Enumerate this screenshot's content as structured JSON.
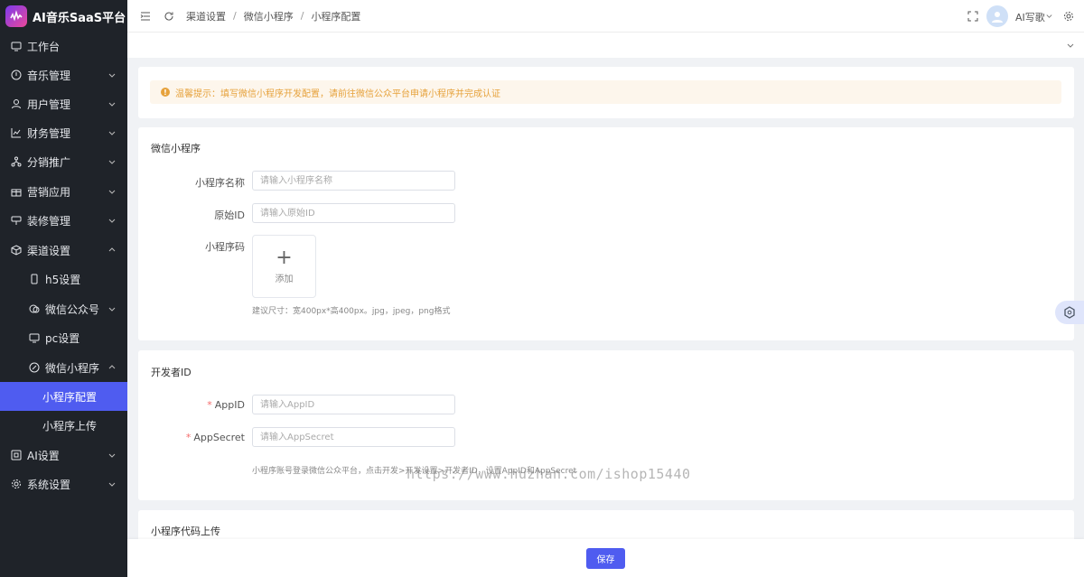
{
  "brand": {
    "title": "AI音乐SaaS平台"
  },
  "sidebar": {
    "items": [
      {
        "label": "工作台",
        "icon": "monitor-icon"
      },
      {
        "label": "音乐管理",
        "icon": "music-icon"
      },
      {
        "label": "用户管理",
        "icon": "user-icon"
      },
      {
        "label": "财务管理",
        "icon": "chart-icon"
      },
      {
        "label": "分销推广",
        "icon": "network-icon"
      },
      {
        "label": "营销应用",
        "icon": "gift-icon"
      },
      {
        "label": "装修管理",
        "icon": "paint-icon"
      },
      {
        "label": "渠道设置",
        "icon": "cube-icon"
      },
      {
        "label": "h5设置",
        "icon": "phone-icon"
      },
      {
        "label": "微信公众号",
        "icon": "wechat-icon"
      },
      {
        "label": "pc设置",
        "icon": "desktop-icon"
      },
      {
        "label": "微信小程序",
        "icon": "miniprogram-icon"
      },
      {
        "label": "小程序配置"
      },
      {
        "label": "小程序上传"
      },
      {
        "label": "AI设置",
        "icon": "ai-icon"
      },
      {
        "label": "系统设置",
        "icon": "gear-icon"
      }
    ]
  },
  "header": {
    "breadcrumb": [
      "渠道设置",
      "微信小程序",
      "小程序配置"
    ],
    "user_name": "AI写歌"
  },
  "alert": {
    "text": "温馨提示：填写微信小程序开发配置，请前往微信公众平台申请小程序并完成认证"
  },
  "section_mini": {
    "title": "微信小程序",
    "name_label": "小程序名称",
    "name_placeholder": "请输入小程序名称",
    "origin_label": "原始ID",
    "origin_placeholder": "请输入原始ID",
    "code_label": "小程序码",
    "upload_label": "添加",
    "upload_hint": "建议尺寸：宽400px*高400px。jpg，jpeg，png格式"
  },
  "section_dev": {
    "title": "开发者ID",
    "appid_label": "AppID",
    "appid_placeholder": "请输入AppID",
    "secret_label": "AppSecret",
    "secret_placeholder": "请输入AppSecret",
    "hint": "小程序账号登录微信公众平台，点击开发>开发设置>开发者ID，设置AppID和AppSecret"
  },
  "section_upload": {
    "title": "小程序代码上传"
  },
  "watermark": "https://www.huzhan.com/ishop15440",
  "footer": {
    "save_label": "保存"
  },
  "colors": {
    "accent": "#4f5cf0",
    "sidebar_bg": "#1f2329",
    "warning": "#e6a23c"
  }
}
